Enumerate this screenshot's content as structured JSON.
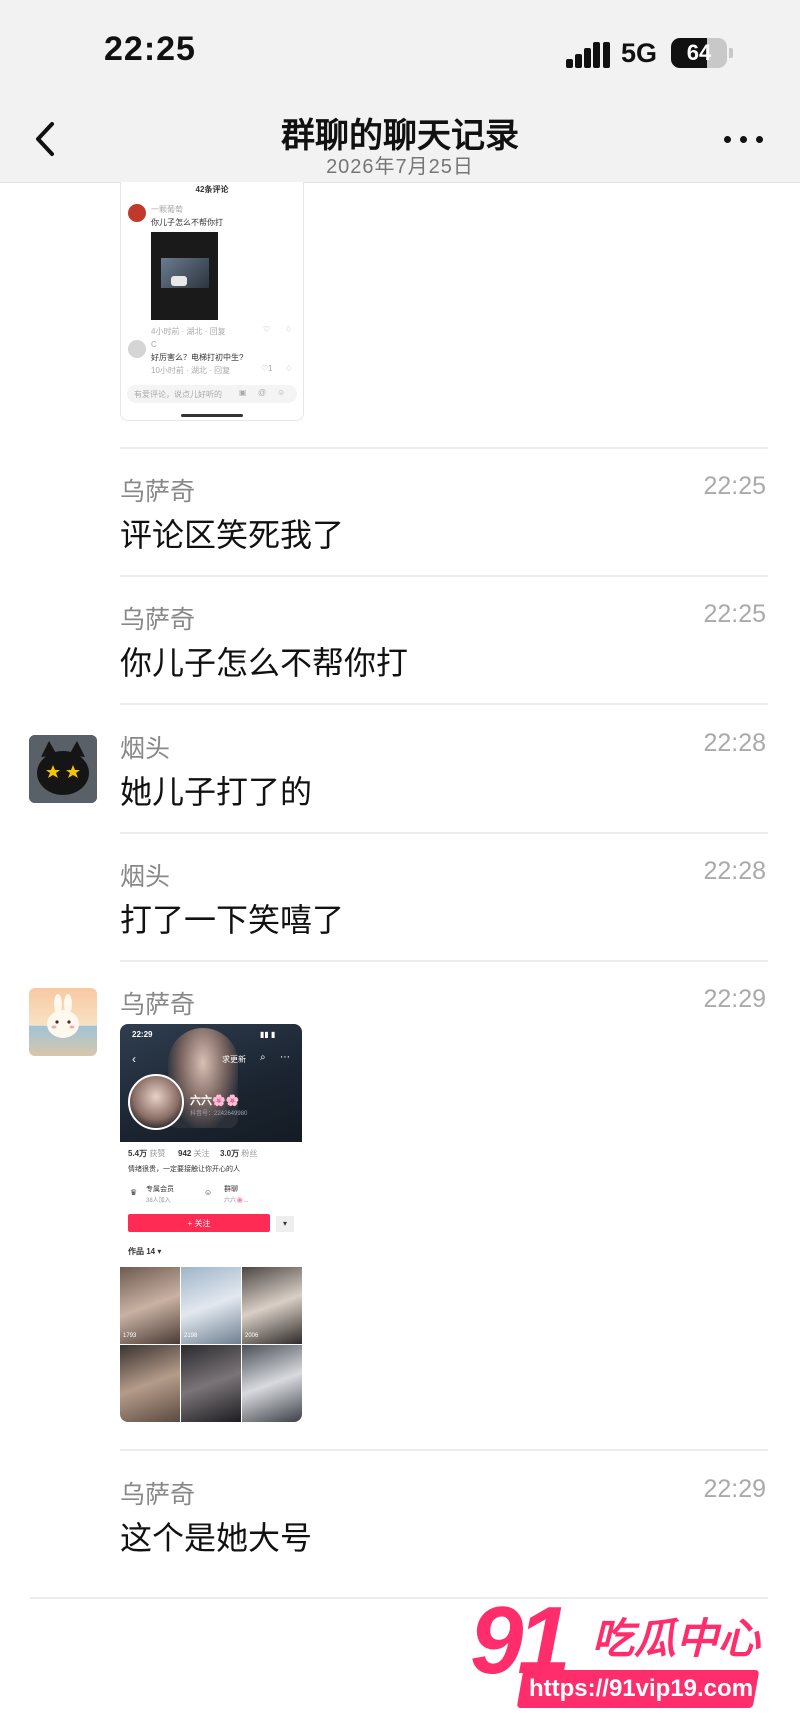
{
  "status_bar": {
    "time": "22:25",
    "network": "5G",
    "battery_level": 64,
    "battery_text": "64"
  },
  "nav": {
    "title": "群聊的聊天记录",
    "subtitle": "2026年7月25日",
    "back_icon": "chevron-left-icon",
    "more_icon": "more-dots-icon"
  },
  "shared_comment_screenshot": {
    "header": "42条评论",
    "comment1_user": "一颗葡萄",
    "comment1_text": "你儿子怎么不帮你打",
    "comment1_meta": "4小时前 · 湖北 · 回复",
    "comment2_user": "C",
    "comment2_text": "好厉害么？电梯打初中生?",
    "comment2_meta": "10小时前 · 湖北 · 回复",
    "comment2_likes": "1",
    "input_placeholder": "有爱评论，说点儿好听的"
  },
  "messages": [
    {
      "sender": "乌萨奇",
      "time": "22:25",
      "text": "评论区笑死我了"
    },
    {
      "sender": "乌萨奇",
      "time": "22:25",
      "text": "你儿子怎么不帮你打"
    },
    {
      "sender": "烟头",
      "time": "22:28",
      "text": "她儿子打了的"
    },
    {
      "sender": "烟头",
      "time": "22:28",
      "text": "打了一下笑嘻了"
    },
    {
      "sender": "乌萨奇",
      "time": "22:29",
      "text": ""
    },
    {
      "sender": "乌萨奇",
      "time": "22:29",
      "text": "这个是她大号"
    }
  ],
  "shared_profile_screenshot": {
    "status_time": "22:29",
    "update_label": "求更新",
    "name": "六六🌸🌸",
    "account": "抖音号：2242649980",
    "stats": [
      {
        "value": "5.4万",
        "label": "获赞"
      },
      {
        "value": "942",
        "label": "关注"
      },
      {
        "value": "3.0万",
        "label": "粉丝"
      }
    ],
    "bio": "情绪很贵，一定要接触让你开心的人",
    "member_title": "专属会员",
    "member_sub": "38人加入",
    "group_title": "群聊",
    "group_sub": "六六🌸...",
    "follow_button": "+ 关注",
    "works_label": "作品 14 ▾",
    "thumb_counts": [
      "1793",
      "2198",
      "2006"
    ]
  },
  "watermark": {
    "logo_number": "91",
    "logo_text": "吃瓜中心",
    "url": "https://91vip19.com"
  }
}
